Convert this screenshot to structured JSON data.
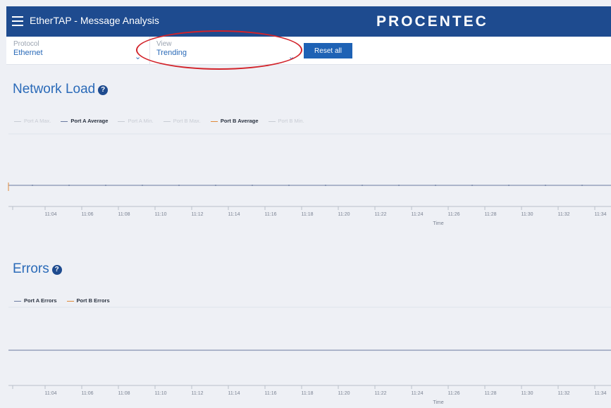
{
  "header": {
    "app_title": "EtherTAP - Message Analysis",
    "brand": "PROCENTEC"
  },
  "filters": {
    "protocol": {
      "label": "Protocol",
      "value": "Ethernet"
    },
    "view": {
      "label": "View",
      "value": "Trending"
    },
    "reset_label": "Reset all"
  },
  "network_load": {
    "title": "Network Load",
    "legend": [
      {
        "label": "Port A Max.",
        "color": "#c8ccd4",
        "active": false
      },
      {
        "label": "Port A Average",
        "color": "#6a7aa0",
        "active": true
      },
      {
        "label": "Port A Min.",
        "color": "#c8ccd4",
        "active": false
      },
      {
        "label": "Port B Max.",
        "color": "#c8ccd4",
        "active": false
      },
      {
        "label": "Port B Average",
        "color": "#e08a3a",
        "active": true
      },
      {
        "label": "Port B Min.",
        "color": "#c8ccd4",
        "active": false
      }
    ]
  },
  "errors": {
    "title": "Errors",
    "legend": [
      {
        "label": "Port A Errors",
        "color": "#6a7aa0",
        "active": true
      },
      {
        "label": "Port B Errors",
        "color": "#e08a3a",
        "active": true
      }
    ]
  },
  "chart_data": [
    {
      "type": "line",
      "x": [
        "11:04",
        "11:06",
        "11:08",
        "11:10",
        "11:12",
        "11:14",
        "11:16",
        "11:18",
        "11:20",
        "11:22",
        "11:24",
        "11:26",
        "11:28",
        "11:30",
        "11:32",
        "11:34"
      ],
      "xlabel": "Time",
      "series": [
        {
          "name": "Port A Average",
          "color": "#6a7aa0",
          "values": [
            1,
            1,
            1,
            1,
            1,
            1,
            1,
            1,
            1,
            1,
            1,
            1,
            1,
            1,
            1,
            1
          ]
        },
        {
          "name": "Port B Average",
          "color": "#e08a3a",
          "values": [
            1,
            1,
            1,
            1,
            1,
            1,
            1,
            1,
            1,
            1,
            1,
            1,
            1,
            1,
            1,
            1
          ]
        }
      ]
    },
    {
      "type": "line",
      "x": [
        "11:04",
        "11:06",
        "11:08",
        "11:10",
        "11:12",
        "11:14",
        "11:16",
        "11:18",
        "11:20",
        "11:22",
        "11:24",
        "11:26",
        "11:28",
        "11:30",
        "11:32",
        "11:34"
      ],
      "xlabel": "Time",
      "series": [
        {
          "name": "Port A Errors",
          "color": "#6a7aa0",
          "values": [
            0,
            0,
            0,
            0,
            0,
            0,
            0,
            0,
            0,
            0,
            0,
            0,
            0,
            0,
            0,
            0
          ]
        },
        {
          "name": "Port B Errors",
          "color": "#e08a3a",
          "values": [
            0,
            0,
            0,
            0,
            0,
            0,
            0,
            0,
            0,
            0,
            0,
            0,
            0,
            0,
            0,
            0
          ]
        }
      ]
    }
  ]
}
